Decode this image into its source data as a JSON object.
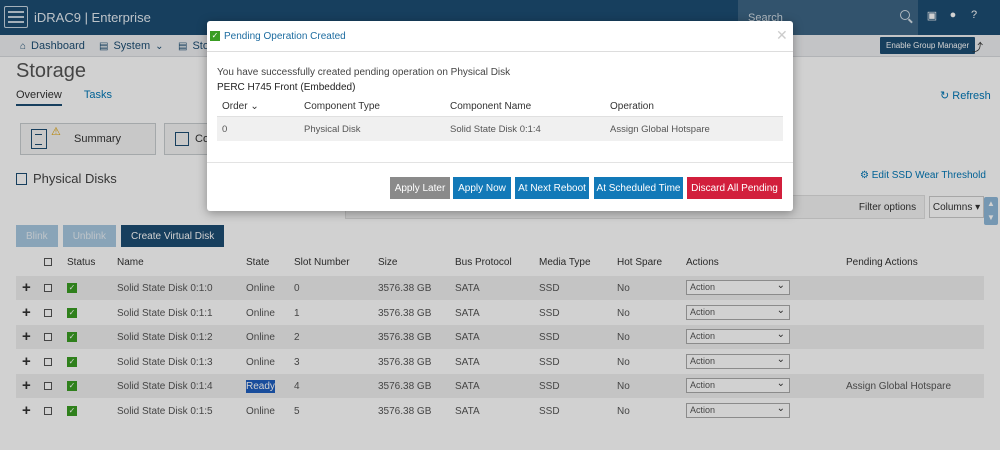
{
  "app": {
    "brand": "iDRAC9 | Enterprise",
    "search_placeholder": "Search"
  },
  "nav": {
    "dashboard": "Dashboard",
    "system": "System",
    "storage": "Sto",
    "enable_group": "Enable Group Manager"
  },
  "page": {
    "title": "Storage",
    "tabs": [
      "Overview",
      "Tasks"
    ],
    "refresh": "Refresh",
    "summary_label": "Summary",
    "controller_label": "Co",
    "section_title": "Physical Disks",
    "edit_ssd": "Edit SSD Wear Threshold",
    "filter_options": "Filter options",
    "columns": "Columns",
    "buttons": {
      "blink": "Blink",
      "unblink": "Unblink",
      "create_vd": "Create Virtual Disk"
    }
  },
  "table": {
    "headers": [
      "Status",
      "Name",
      "State",
      "Slot Number",
      "Size",
      "Bus Protocol",
      "Media Type",
      "Hot Spare",
      "Actions",
      "Pending Actions"
    ],
    "action_default": "Action",
    "rows": [
      {
        "name": "Solid State Disk 0:1:0",
        "state": "Online",
        "slot": "0",
        "size": "3576.38 GB",
        "bus": "SATA",
        "media": "SSD",
        "hotspare": "No",
        "pending": ""
      },
      {
        "name": "Solid State Disk 0:1:1",
        "state": "Online",
        "slot": "1",
        "size": "3576.38 GB",
        "bus": "SATA",
        "media": "SSD",
        "hotspare": "No",
        "pending": ""
      },
      {
        "name": "Solid State Disk 0:1:2",
        "state": "Online",
        "slot": "2",
        "size": "3576.38 GB",
        "bus": "SATA",
        "media": "SSD",
        "hotspare": "No",
        "pending": ""
      },
      {
        "name": "Solid State Disk 0:1:3",
        "state": "Online",
        "slot": "3",
        "size": "3576.38 GB",
        "bus": "SATA",
        "media": "SSD",
        "hotspare": "No",
        "pending": ""
      },
      {
        "name": "Solid State Disk 0:1:4",
        "state": "Ready",
        "slot": "4",
        "size": "3576.38 GB",
        "bus": "SATA",
        "media": "SSD",
        "hotspare": "No",
        "pending": "Assign Global Hotspare"
      },
      {
        "name": "Solid State Disk 0:1:5",
        "state": "Online",
        "slot": "5",
        "size": "3576.38 GB",
        "bus": "SATA",
        "media": "SSD",
        "hotspare": "No",
        "pending": ""
      }
    ]
  },
  "modal": {
    "title": "Pending Operation Created",
    "message": "You have successfully created pending operation on Physical Disk",
    "controller": "PERC H745 Front (Embedded)",
    "headers": [
      "Order",
      "Component Type",
      "Component Name",
      "Operation"
    ],
    "row": {
      "order": "0",
      "type": "Physical Disk",
      "name": "Solid State Disk 0:1:4",
      "operation": "Assign Global Hotspare"
    },
    "buttons": {
      "apply_later": "Apply Later",
      "apply_now": "Apply Now",
      "next_reboot": "At Next Reboot",
      "scheduled": "At Scheduled Time",
      "discard": "Discard All Pending"
    }
  },
  "colors": {
    "brand": "#1d4d73",
    "link": "#0077b6",
    "success": "#3a9d23",
    "danger": "#d21f3c"
  }
}
